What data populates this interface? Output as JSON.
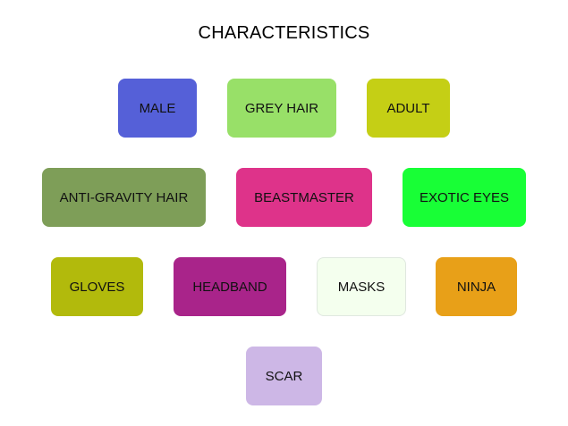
{
  "title": "CHARACTERISTICS",
  "tags": [
    {
      "label": "MALE",
      "color": "#5560D8"
    },
    {
      "label": "GREY HAIR",
      "color": "#98E068"
    },
    {
      "label": "ADULT",
      "color": "#C5CF15"
    },
    {
      "label": "ANTI-GRAVITY HAIR",
      "color": "#7E9E58"
    },
    {
      "label": "BEASTMASTER",
      "color": "#DE338A"
    },
    {
      "label": "EXOTIC EYES",
      "color": "#18FF36"
    },
    {
      "label": "GLOVES",
      "color": "#B2BA0C"
    },
    {
      "label": "HEADBAND",
      "color": "#A9248A"
    },
    {
      "label": "MASKS",
      "color": "#F4FFEE"
    },
    {
      "label": "NINJA",
      "color": "#E8A018"
    },
    {
      "label": "SCAR",
      "color": "#CDB7E6"
    }
  ]
}
